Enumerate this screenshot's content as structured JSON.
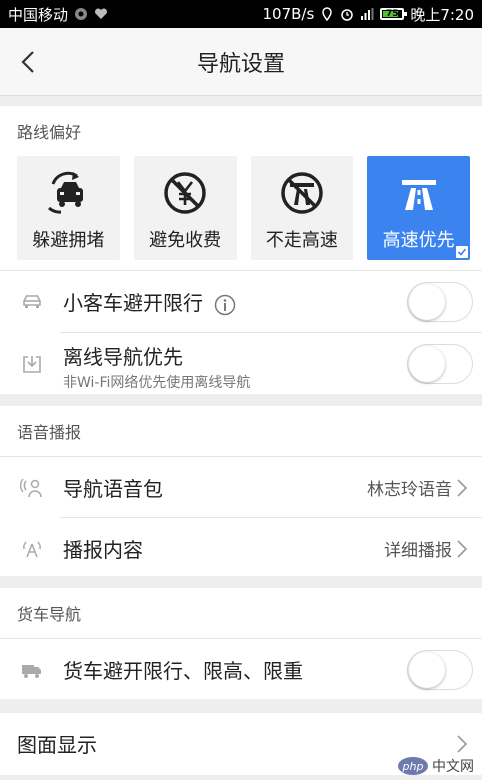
{
  "status_bar": {
    "carrier": "中国移动",
    "speed": "107B/s",
    "battery": "75",
    "time": "晚上7:20"
  },
  "nav": {
    "title": "导航设置",
    "back_icon": "chevron-left-icon"
  },
  "route_preference": {
    "header": "路线偏好",
    "options": [
      {
        "label": "躲避拥堵",
        "icon": "avoid-congestion-icon",
        "selected": false
      },
      {
        "label": "避免收费",
        "icon": "no-toll-icon",
        "selected": false
      },
      {
        "label": "不走高速",
        "icon": "no-highway-icon",
        "selected": false
      },
      {
        "label": "高速优先",
        "icon": "highway-icon",
        "selected": true
      }
    ],
    "rows": [
      {
        "title": "小客车避开限行",
        "icon": "car-icon",
        "info_icon": "info-icon",
        "on": false
      },
      {
        "title": "离线导航优先",
        "subtitle": "非Wi-Fi网络优先使用离线导航",
        "icon": "offline-download-icon",
        "on": false
      }
    ]
  },
  "voice": {
    "header": "语音播报",
    "rows": [
      {
        "title": "导航语音包",
        "value": "林志玲语音",
        "icon": "voice-pack-icon"
      },
      {
        "title": "播报内容",
        "value": "详细播报",
        "icon": "broadcast-icon"
      }
    ]
  },
  "truck": {
    "header": "货车导航",
    "rows": [
      {
        "title": "货车避开限行、限高、限重",
        "icon": "truck-icon",
        "on": false
      }
    ]
  },
  "display": {
    "title": "图面显示"
  },
  "watermark": {
    "logo": "php",
    "text": "中文网"
  },
  "colors": {
    "accent": "#3b84f0",
    "background": "#eeeeee",
    "status_bar": "#000000"
  }
}
